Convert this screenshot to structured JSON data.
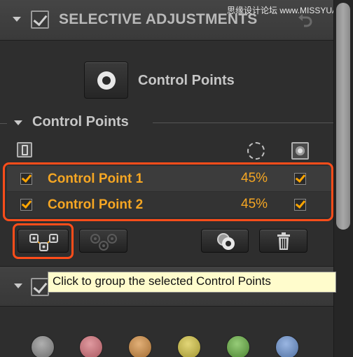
{
  "header": {
    "title": "SELECTIVE ADJUSTMENTS",
    "watermark": "思缘设计论坛 www.MISSYUAN.COM",
    "enabled": true
  },
  "tool": {
    "label": "Control Points",
    "icon": "control-point-icon"
  },
  "section": {
    "title": "Control Points",
    "columns": {
      "left_icon": "show-hide-icon",
      "mid_icon": "opacity-circle-icon",
      "right_icon": "mask-icon"
    }
  },
  "rows": [
    {
      "name": "Control Point 1",
      "opacity": "45%",
      "enabled": true,
      "masked": true
    },
    {
      "name": "Control Point 2",
      "opacity": "45%",
      "enabled": true,
      "masked": true
    }
  ],
  "toolbar": {
    "group_icon": "group-points-icon",
    "ungroup_icon": "ungroup-points-icon",
    "duplicate_icon": "duplicate-point-icon",
    "delete_icon": "trash-icon"
  },
  "tooltip": {
    "text": "Click to group the selected Control Points"
  },
  "colors": {
    "accent_orange": "#f5a623",
    "highlight_red": "#ff4d1a",
    "tooltip_bg": "#fffccc",
    "dots": [
      "#8a8a8a",
      "#c8727a",
      "#c98a4a",
      "#c8b84a",
      "#6aa24a",
      "#6f8fc0"
    ]
  }
}
